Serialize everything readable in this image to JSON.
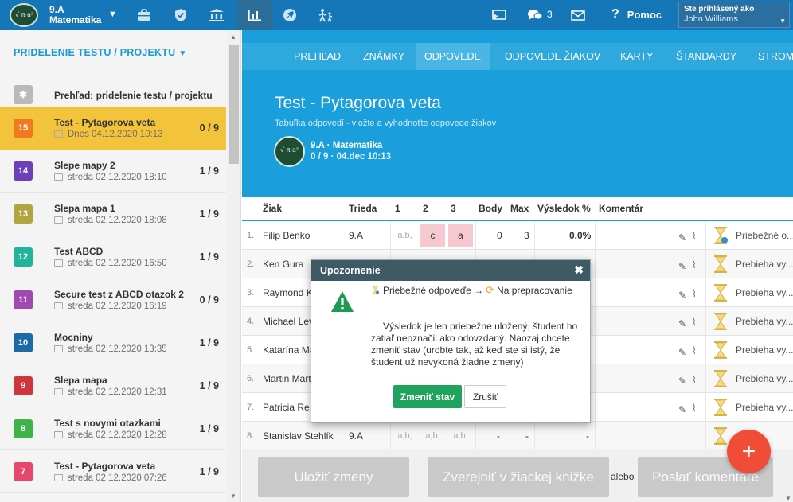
{
  "topbar": {
    "class_name": "9.A",
    "subject": "Matematika",
    "messages_count": "3",
    "help_label": "Pomoc",
    "user_caption": "Ste prihlásený ako",
    "user_name": "John Williams",
    "icons": [
      "briefcase-icon",
      "shield-icon",
      "institution-icon",
      "bar-chart-icon",
      "rocket-icon",
      "family-icon",
      "cast-icon",
      "chat-icon",
      "mail-icon",
      "help-icon"
    ]
  },
  "sidebar": {
    "heading": "PRIDELENIE TESTU / PROJEKTU",
    "overview_label": "Prehľad: pridelenie testu / projektu",
    "items": [
      {
        "badge": "15",
        "color": "#f07b1e",
        "title": "Test - Pytagorova veta",
        "date": "Dnes 04.12.2020 10:13",
        "score": "0 / 9"
      },
      {
        "badge": "14",
        "color": "#6f3fb8",
        "title": "Slepe mapy 2",
        "date": "streda 02.12.2020 18:10",
        "score": "1 / 9"
      },
      {
        "badge": "13",
        "color": "#b2a540",
        "title": "Slepa mapa 1",
        "date": "streda 02.12.2020 18:08",
        "score": "1 / 9"
      },
      {
        "badge": "12",
        "color": "#21b49a",
        "title": "Test ABCD",
        "date": "streda 02.12.2020 16:50",
        "score": "1 / 9"
      },
      {
        "badge": "11",
        "color": "#a04ab0",
        "title": "Secure test z ABCD otazok 2",
        "date": "streda 02.12.2020 16:19",
        "score": "0 / 9"
      },
      {
        "badge": "10",
        "color": "#1d6aa8",
        "title": "Mocniny",
        "date": "streda 02.12.2020 13:35",
        "score": "1 / 9"
      },
      {
        "badge": "9",
        "color": "#d0353b",
        "title": "Slepa mapa",
        "date": "streda 02.12.2020 12:31",
        "score": "1 / 9"
      },
      {
        "badge": "8",
        "color": "#3fb24a",
        "title": "Test s novymi otazkami",
        "date": "streda 02.12.2020 12:28",
        "score": "1 / 9"
      },
      {
        "badge": "7",
        "color": "#e4486a",
        "title": "Test - Pytagorova veta",
        "date": "streda 02.12.2020 07:26",
        "score": "1 / 9"
      }
    ]
  },
  "tabs": [
    "PREHĽAD",
    "ZNÁMKY",
    "ODPOVEDE",
    "ODPOVEDE ŽIAKOV",
    "KARTY",
    "ŠTANDARDY",
    "STROM"
  ],
  "header": {
    "title": "Test - Pytagorova veta",
    "subtitle": "Tabuľka odpovedí - vložte a vyhodnoťte odpovede žiakov",
    "class_subject": "9.A · Matematika",
    "info": "0 / 9 · 04.dec 10:13"
  },
  "table": {
    "columns": [
      "Žiak",
      "Trieda",
      "1",
      "2",
      "3",
      "Body",
      "Max",
      "Výsledok %",
      "Komentár"
    ],
    "rows": [
      {
        "n": "1.",
        "name": "Filip Benko",
        "class": "9.A",
        "a1": "a,b,",
        "a2": "c",
        "a3": "a",
        "body": "0",
        "max": "3",
        "pct": "0.0%",
        "status": "Priebežné o..."
      },
      {
        "n": "2.",
        "name": "Ken Gura",
        "class": "9.A",
        "a1": "",
        "a2": "",
        "a3": "",
        "body": "",
        "max": "",
        "pct": "",
        "status": "Prebieha vy..."
      },
      {
        "n": "3.",
        "name": "Raymond K",
        "class": "",
        "a1": "",
        "a2": "",
        "a3": "",
        "body": "",
        "max": "",
        "pct": "",
        "status": "Prebieha vy..."
      },
      {
        "n": "4.",
        "name": "Michael Lev",
        "class": "",
        "a1": "",
        "a2": "",
        "a3": "",
        "body": "",
        "max": "",
        "pct": "",
        "status": "Prebieha vy..."
      },
      {
        "n": "5.",
        "name": "Katarína Ma",
        "class": "",
        "a1": "",
        "a2": "",
        "a3": "",
        "body": "",
        "max": "",
        "pct": "",
        "status": "Prebieha vy..."
      },
      {
        "n": "6.",
        "name": "Martin Mart",
        "class": "",
        "a1": "",
        "a2": "",
        "a3": "",
        "body": "",
        "max": "",
        "pct": "",
        "status": "Prebieha vy..."
      },
      {
        "n": "7.",
        "name": "Patricia Re",
        "class": "",
        "a1": "",
        "a2": "",
        "a3": "",
        "body": "",
        "max": "",
        "pct": "",
        "status": "Prebieha vy..."
      },
      {
        "n": "8.",
        "name": "Stanislav Stehlík",
        "class": "9.A",
        "a1": "a,b,",
        "a2": "a,b,",
        "a3": "a,b,",
        "body": "-",
        "max": "-",
        "pct": "-",
        "status": ""
      }
    ]
  },
  "footer": {
    "save": "Uložiť zmeny",
    "publish": "Zverejniť v žiackej knižke",
    "or": "alebo",
    "send": "Poslať komentáre"
  },
  "modal": {
    "title": "Upozornenie",
    "line1_a": "Priebežné odpoveďe →",
    "line1_b": "Na prepracovanie",
    "body": "Výsledok je len priebežne uložený, študent ho zatiaľ neoznačil ako odovzdaný. Naozaj chcete zmeniť stav (urobte tak, až keď ste si istý, že študent už nevykoná žiadne zmeny)",
    "ok": "Zmeniť stav",
    "cancel": "Zrušiť"
  },
  "colors": {
    "topbar": "#1577b8",
    "header": "#1a9edc",
    "active_item": "#f3c33c",
    "ok_button": "#20a35d",
    "fab": "#f04c37",
    "wrong_answer": "#f6c9d1"
  }
}
